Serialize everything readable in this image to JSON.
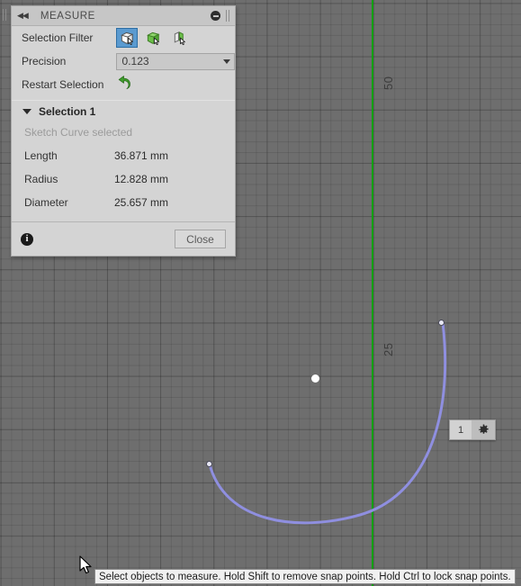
{
  "app": {
    "canvas_background": "#6e6e6e",
    "axis_color": "#12a012",
    "curve_color": "#8f8fe0",
    "accent_color": "#5a9ad0"
  },
  "panel": {
    "title": "MEASURE",
    "collapse_icon": "collapse-left-arrows-icon",
    "minimize_icon": "minimize-icon",
    "rows": {
      "selection_filter_label": "Selection Filter",
      "precision_label": "Precision",
      "precision_value": "0.123",
      "restart_label": "Restart Selection",
      "restart_icon": "undo-arrow-icon"
    },
    "filters": [
      {
        "name": "filter-select-body",
        "active": true
      },
      {
        "name": "filter-select-face",
        "active": false
      },
      {
        "name": "filter-select-sketch",
        "active": false
      }
    ],
    "section": {
      "header": "Selection 1",
      "hint": "Sketch Curve selected",
      "properties": [
        {
          "name": "Length",
          "value": "36.871 mm"
        },
        {
          "name": "Radius",
          "value": "12.828 mm"
        },
        {
          "name": "Diameter",
          "value": "25.657 mm"
        }
      ]
    },
    "footer": {
      "info_icon": "info-icon",
      "info_glyph": "i",
      "close_label": "Close"
    }
  },
  "canvas": {
    "dimension_labels": [
      {
        "text": "50",
        "name": "dimension-label-50"
      },
      {
        "text": "25",
        "name": "dimension-label-25"
      }
    ],
    "snap_widget": {
      "count": "1",
      "gear_icon": "gear-icon"
    }
  },
  "statusbar": {
    "message": "Select objects to measure. Hold Shift to remove snap points. Hold Ctrl to lock snap points."
  }
}
